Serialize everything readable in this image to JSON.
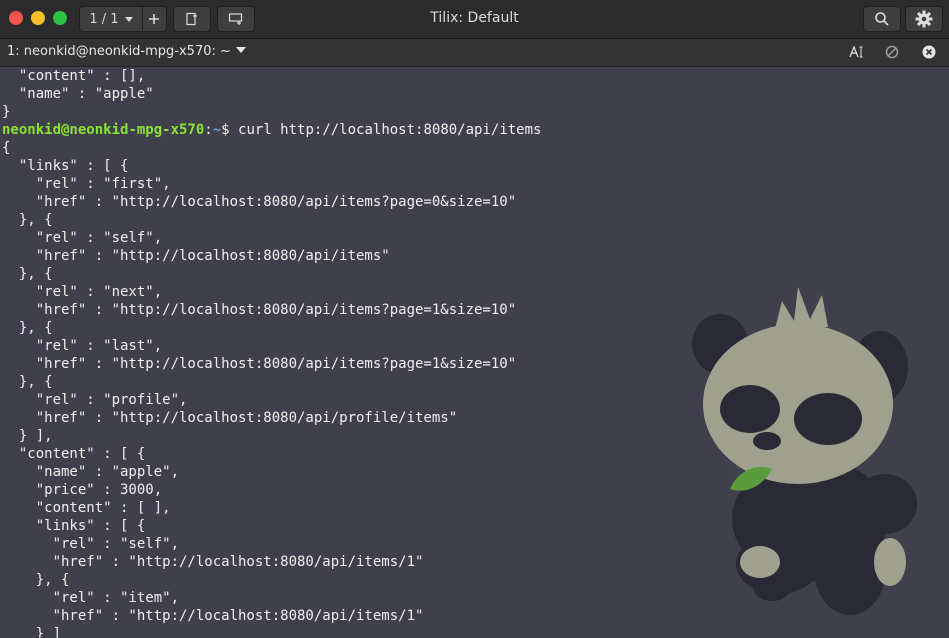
{
  "window": {
    "title": "Tilix: Default",
    "session_counter": "1 / 1"
  },
  "tab": {
    "label": "1: neonkid@neonkid-mpg-x570: ~"
  },
  "terminal": {
    "lines": [
      "  \"content\" : [],",
      "  \"name\" : \"apple\"",
      "}",
      {
        "prompt_user": "neonkid@neonkid-mpg-x570",
        "prompt_sep": ":",
        "prompt_path": "~",
        "prompt_symbol": "$ ",
        "command": "curl http://localhost:8080/api/items"
      },
      "{",
      "  \"links\" : [ {",
      "    \"rel\" : \"first\",",
      "    \"href\" : \"http://localhost:8080/api/items?page=0&size=10\"",
      "  }, {",
      "    \"rel\" : \"self\",",
      "    \"href\" : \"http://localhost:8080/api/items\"",
      "  }, {",
      "    \"rel\" : \"next\",",
      "    \"href\" : \"http://localhost:8080/api/items?page=1&size=10\"",
      "  }, {",
      "    \"rel\" : \"last\",",
      "    \"href\" : \"http://localhost:8080/api/items?page=1&size=10\"",
      "  }, {",
      "    \"rel\" : \"profile\",",
      "    \"href\" : \"http://localhost:8080/api/profile/items\"",
      "  } ],",
      "  \"content\" : [ {",
      "    \"name\" : \"apple\",",
      "    \"price\" : 3000,",
      "    \"content\" : [ ],",
      "    \"links\" : [ {",
      "      \"rel\" : \"self\",",
      "      \"href\" : \"http://localhost:8080/api/items/1\"",
      "    }, {",
      "      \"rel\" : \"item\",",
      "      \"href\" : \"http://localhost:8080/api/items/1\"",
      "    } ]"
    ]
  },
  "colors": {
    "background": "#3f404b",
    "prompt_user": "#8ae234",
    "prompt_path": "#729fcf",
    "text": "#f0f0f0"
  },
  "icons": {
    "session_add": "plus-icon",
    "add_terminal_right": "add-terminal-right-icon",
    "add_terminal_down": "add-terminal-down-icon",
    "search": "search-icon",
    "menu": "gear-icon",
    "tab_title_edit": "text-cursor-icon",
    "read_only": "read-only-icon",
    "close": "close-icon"
  }
}
